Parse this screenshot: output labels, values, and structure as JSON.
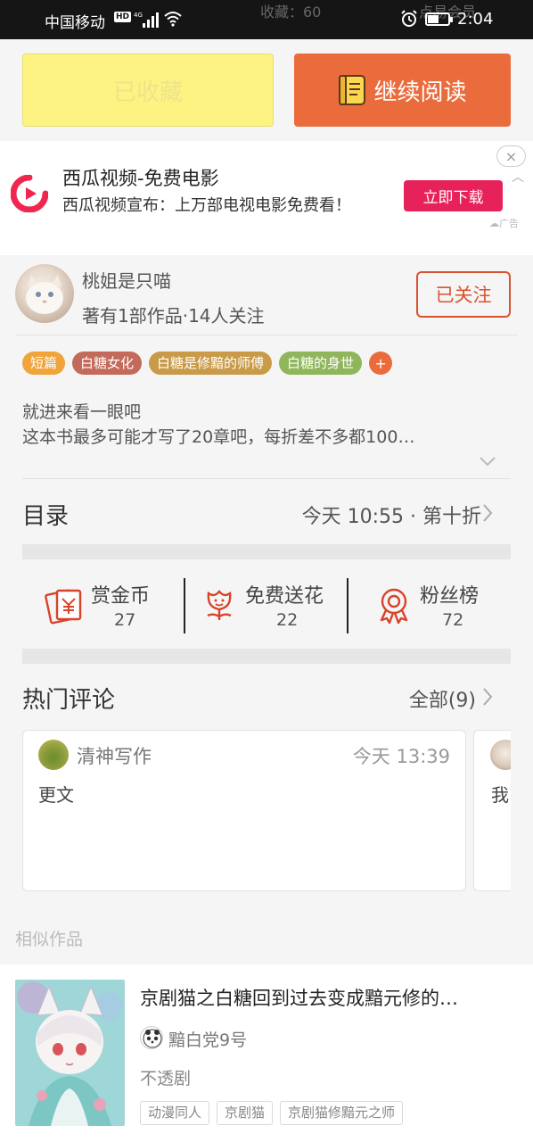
{
  "status_bar": {
    "carrier": "中国移动",
    "hd": "HD",
    "net": "4G",
    "behind_left": "收藏：60",
    "behind_right": "点易会员",
    "time": "2:04"
  },
  "top_actions": {
    "favorited_label": "已收藏",
    "continue_label": "继续阅读"
  },
  "ad": {
    "title": "西瓜视频-免费电影",
    "description": "西瓜视频宣布：上万部电视电影免费看！",
    "download_label": "立即下载",
    "close_symbol": "×",
    "ad_label": "广告"
  },
  "author": {
    "name": "桃姐是只喵",
    "stats": "著有1部作品·14人关注",
    "follow_label": "已关注"
  },
  "tags": [
    {
      "label": "短篇",
      "color": "#f0a43a"
    },
    {
      "label": "白糖女化",
      "color": "#c36a5a"
    },
    {
      "label": "白糖是修黯的师傅",
      "color": "#c99a48"
    },
    {
      "label": "白糖的身世",
      "color": "#8fb65a"
    }
  ],
  "tag_add_symbol": "+",
  "description": {
    "line1": "就进来看一眼吧",
    "line2": "这本书最多可能才写了20章吧，每折差不多都100…"
  },
  "catalog": {
    "label": "目录",
    "meta": "今天 10:55 · 第十折"
  },
  "stats": {
    "reward": {
      "label": "赏金币",
      "value": "27"
    },
    "flowers": {
      "label": "免费送花",
      "value": "22"
    },
    "fans": {
      "label": "粉丝榜",
      "value": "72"
    }
  },
  "hot_comments": {
    "label": "热门评论",
    "all_label": "全部(9)",
    "items": [
      {
        "user": "清神写作",
        "time": "今天 13:39",
        "text": "更文"
      },
      {
        "text": "我"
      }
    ]
  },
  "similar": {
    "label": "相似作品",
    "item": {
      "title": "京剧猫之白糖回到过去变成黯元修的…",
      "author": "黯白党9号",
      "description": "不透剧",
      "tags": [
        "动漫同人",
        "京剧猫",
        "京剧猫修黯元之师"
      ]
    }
  },
  "colors": {
    "accent": "#ea6c3d",
    "favorite_bg": "#fdf383",
    "follow": "#d9532f",
    "icon_red": "#d9432a",
    "ad_button": "#e7225a"
  }
}
